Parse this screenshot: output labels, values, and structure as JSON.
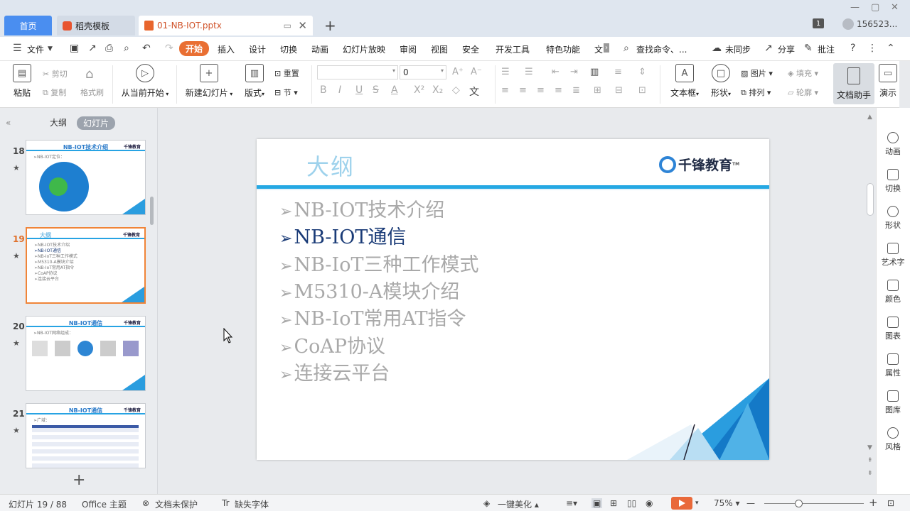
{
  "tabs": {
    "home": "首页",
    "docer": "稻壳模板",
    "file": "01-NB-IOT.pptx",
    "window_count": "1",
    "user": "156523..."
  },
  "menu": {
    "file": "文件",
    "items": [
      "开始",
      "插入",
      "设计",
      "切换",
      "动画",
      "幻灯片放映",
      "审阅",
      "视图",
      "安全",
      "开发工具",
      "特色功能",
      "文"
    ],
    "search": "查找命令、...",
    "sync": "未同步",
    "share": "分享",
    "comment": "批注"
  },
  "ribbon": {
    "paste": "粘贴",
    "cut": "剪切",
    "copy": "复制",
    "format_painter": "格式刷",
    "from_current": "从当前开始",
    "new_slide": "新建幻灯片",
    "layout": "版式",
    "reset": "重置",
    "section": "节",
    "font_size": "0",
    "textbox": "文本框",
    "shape": "形状",
    "picture": "图片",
    "fill": "填充",
    "arrange": "排列",
    "outline": "轮廓",
    "doc_helper": "文档助手",
    "present": "演示"
  },
  "left_panel": {
    "tab_outline": "大纲",
    "tab_slides": "幻灯片",
    "slides": [
      {
        "num": "18",
        "title": "NB-IOT技术介绍",
        "lines": [
          "➢NB-IOT定位："
        ]
      },
      {
        "num": "19",
        "title": "大纲",
        "lines": [
          "➢NB-IOT技术介绍",
          "➢NB-IOT通信",
          "➢NB-IoT三种工作模式",
          "➢M5310-A模块介绍",
          "➢NB-IoT常用AT指令",
          "➢CoAP协议",
          "➢连接云平台"
        ]
      },
      {
        "num": "20",
        "title": "NB-IOT通信",
        "lines": [
          "➢NB-IOT网络组成："
        ]
      },
      {
        "num": "21",
        "title": "NB-IOT通信",
        "lines": [
          "➢广域："
        ]
      }
    ],
    "add": "+"
  },
  "slide": {
    "title": "大纲",
    "logo": "千锋教育",
    "logo_tm": "TM",
    "bullets": [
      {
        "text": "NB-IOT技术介绍",
        "active": false
      },
      {
        "text": "NB-IOT通信",
        "active": true
      },
      {
        "text": "NB-IoT三种工作模式",
        "active": false
      },
      {
        "text": "M5310-A模块介绍",
        "active": false
      },
      {
        "text": "NB-IoT常用AT指令",
        "active": false
      },
      {
        "text": "CoAP协议",
        "active": false
      },
      {
        "text": "连接云平台",
        "active": false
      }
    ],
    "arrow": "➢"
  },
  "right_sidebar": [
    "动画",
    "切换",
    "形状",
    "艺术字",
    "颜色",
    "图表",
    "属性",
    "图库",
    "风格"
  ],
  "status": {
    "slide_info": "幻灯片 19 / 88",
    "theme": "Office 主题",
    "protect": "文档未保护",
    "missing_font": "缺失字体",
    "beautify": "一键美化",
    "zoom": "75%"
  },
  "colors": {
    "accent": "#e96f33",
    "home_tab": "#4a8ef0",
    "slide_bar": "#25a8e3",
    "active_bullet": "#1a3b77",
    "inactive_bullet": "#a9a9a9"
  }
}
